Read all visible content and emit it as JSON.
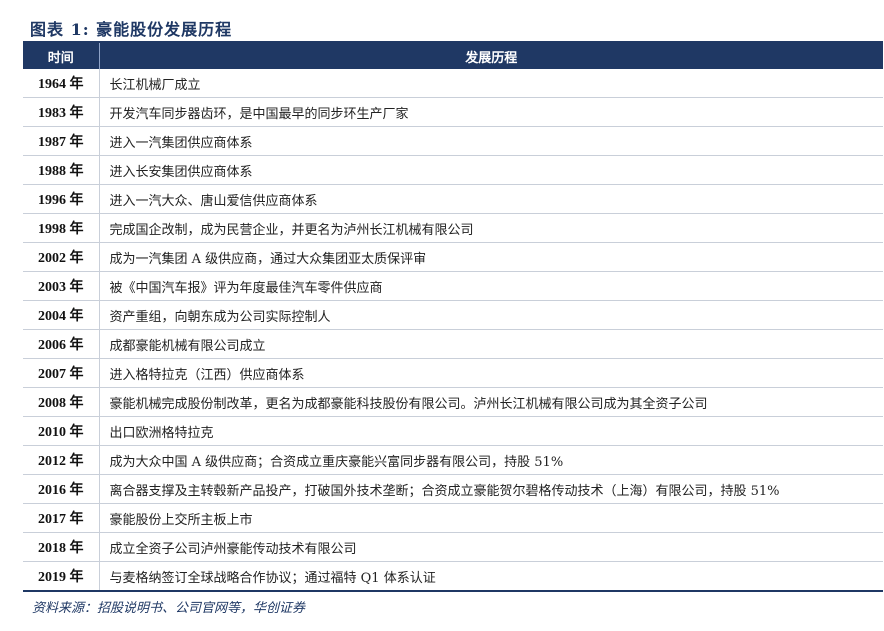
{
  "title": "图表 1:  豪能股份发展历程",
  "table": {
    "headers": [
      "时间",
      "发展历程"
    ],
    "rows": [
      {
        "year": "1964 年",
        "event": "长江机械厂成立"
      },
      {
        "year": "1983 年",
        "event": "开发汽车同步器齿环，是中国最早的同步环生产厂家"
      },
      {
        "year": "1987 年",
        "event": "进入一汽集团供应商体系"
      },
      {
        "year": "1988 年",
        "event": "进入长安集团供应商体系"
      },
      {
        "year": "1996 年",
        "event": "进入一汽大众、唐山爱信供应商体系"
      },
      {
        "year": "1998 年",
        "event": "完成国企改制，成为民营企业，并更名为泸州长江机械有限公司"
      },
      {
        "year": "2002 年",
        "event": "成为一汽集团 A 级供应商，通过大众集团亚太质保评审"
      },
      {
        "year": "2003 年",
        "event": "被《中国汽车报》评为年度最佳汽车零件供应商"
      },
      {
        "year": "2004 年",
        "event": "资产重组，向朝东成为公司实际控制人"
      },
      {
        "year": "2006 年",
        "event": "成都豪能机械有限公司成立"
      },
      {
        "year": "2007 年",
        "event": "进入格特拉克（江西）供应商体系"
      },
      {
        "year": "2008 年",
        "event": "豪能机械完成股份制改革，更名为成都豪能科技股份有限公司。泸州长江机械有限公司成为其全资子公司"
      },
      {
        "year": "2010 年",
        "event": "出口欧洲格特拉克"
      },
      {
        "year": "2012 年",
        "event": "成为大众中国 A 级供应商；合资成立重庆豪能兴富同步器有限公司，持股 51%"
      },
      {
        "year": "2016 年",
        "event": "离合器支撑及主转毂新产品投产，打破国外技术垄断；合资成立豪能贺尔碧格传动技术（上海）有限公司，持股 51%"
      },
      {
        "year": "2017 年",
        "event": "豪能股份上交所主板上市"
      },
      {
        "year": "2018 年",
        "event": "成立全资子公司泸州豪能传动技术有限公司"
      },
      {
        "year": "2019 年",
        "event": "与麦格纳签订全球战略合作协议；通过福特 Q1 体系认证"
      }
    ]
  },
  "source": "资料来源：招股说明书、公司官网等，华创证券",
  "colors": {
    "header_bg": "#1f3864",
    "header_text": "#ffffff",
    "row_border": "#c9cfd9",
    "title": "#1f3864"
  }
}
